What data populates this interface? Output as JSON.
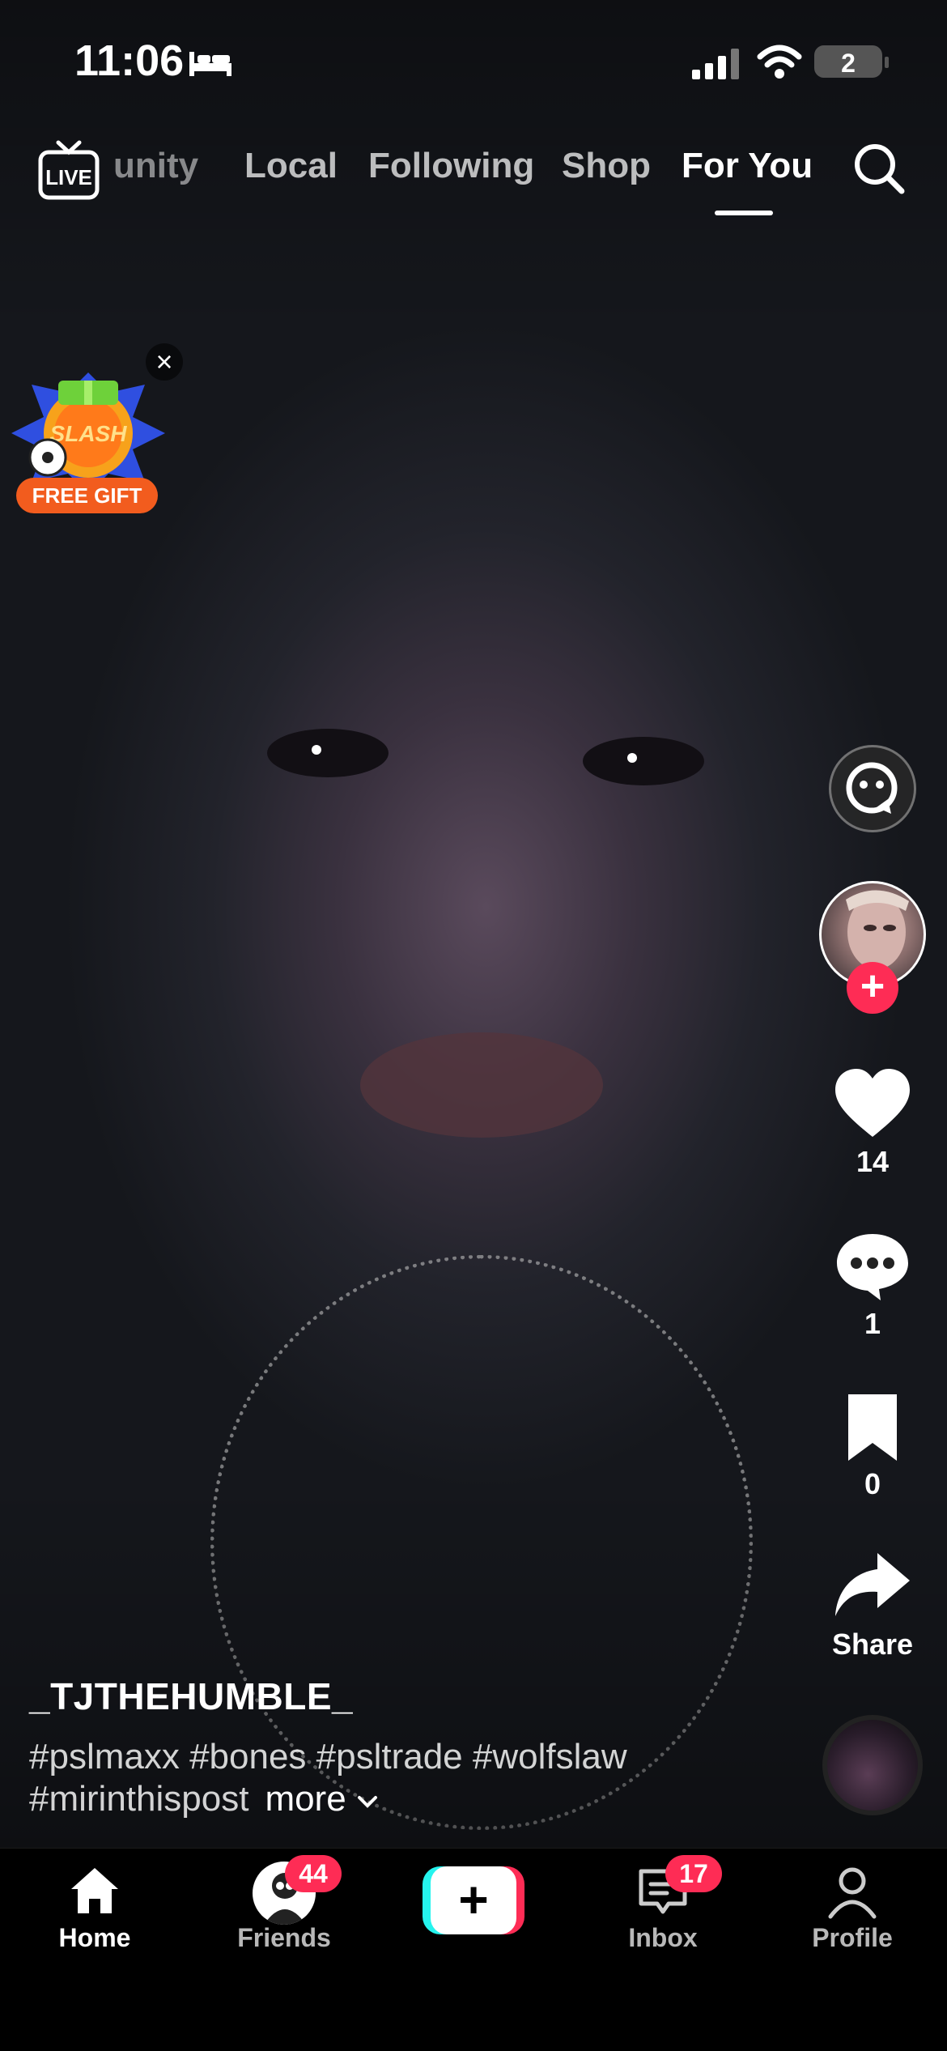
{
  "status_bar": {
    "time": "11:06",
    "focus_icon": "bed-icon",
    "battery_level": "2"
  },
  "top_nav": {
    "tabs": [
      {
        "label": "unity",
        "active": false
      },
      {
        "label": "Local",
        "active": false
      },
      {
        "label": "Following",
        "active": false
      },
      {
        "label": "Shop",
        "active": false
      },
      {
        "label": "For You",
        "active": true
      }
    ],
    "live_label": "LIVE"
  },
  "promo": {
    "title": "SLASH",
    "label": "FREE GIFT"
  },
  "actions": {
    "likes": "14",
    "comments": "1",
    "bookmarks": "0",
    "share_label": "Share"
  },
  "post": {
    "username": "_TJTHEHUMBLE_",
    "caption": "#pslmaxx #bones #psltrade #wolfslaw #mirinthispost",
    "more_label": "more"
  },
  "bottom_nav": {
    "home": "Home",
    "friends": "Friends",
    "friends_badge": "44",
    "inbox": "Inbox",
    "inbox_badge": "17",
    "profile": "Profile",
    "create_symbol": "+"
  },
  "colors": {
    "accent": "#fe2c55",
    "cyan": "#25f4ee",
    "background": "#000000"
  }
}
